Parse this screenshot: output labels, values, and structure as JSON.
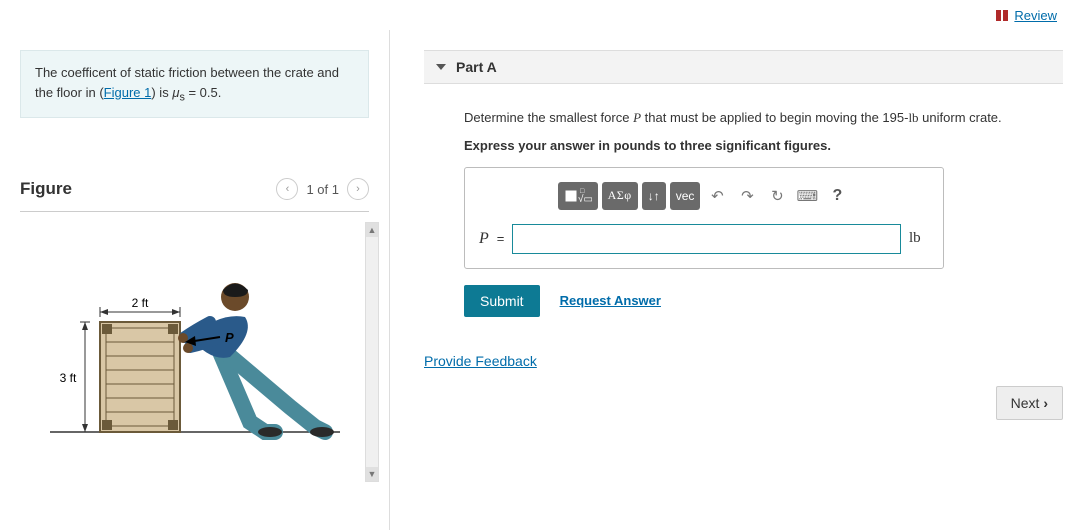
{
  "header": {
    "review_label": "Review"
  },
  "problem": {
    "text_pre": "The coefficent of static friction between the crate and the floor in (",
    "figure_link": "Figure 1",
    "text_post": ") is ",
    "mu_symbol": "μ",
    "mu_sub": "s",
    "equals": " = 0.5."
  },
  "figure": {
    "title": "Figure",
    "counter": "1 of 1",
    "dim_width": "2 ft",
    "dim_height": "3 ft",
    "force_label": "P"
  },
  "partA": {
    "header": "Part A",
    "question_pre": "Determine the smallest force ",
    "question_var": "P",
    "question_mid": " that must be applied to begin moving the 195-",
    "question_unit": "lb",
    "question_post": " uniform crate.",
    "instruction": "Express your answer in pounds to three significant figures.",
    "toolbar": {
      "templates": "▭√▭",
      "greek": "ΑΣφ",
      "subsup": "↓↑",
      "vec": "vec",
      "undo": "↶",
      "redo": "↷",
      "reset": "↻",
      "keyboard": "⌨",
      "help": "?"
    },
    "input": {
      "var": "P",
      "equals": "=",
      "value": "",
      "unit": "lb"
    },
    "submit_label": "Submit",
    "request_label": "Request Answer"
  },
  "feedback_label": "Provide Feedback",
  "next_label": "Next"
}
